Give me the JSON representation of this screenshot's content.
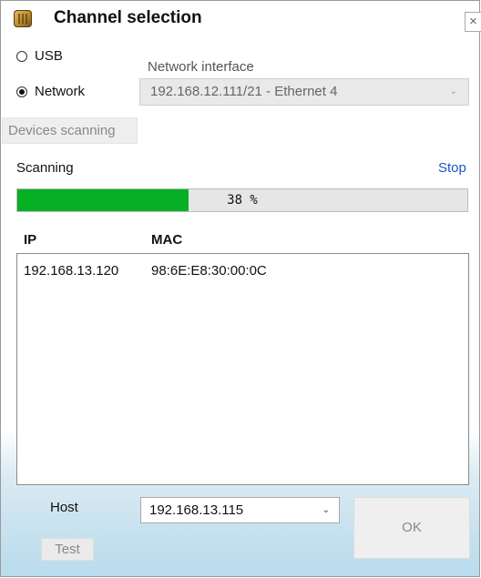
{
  "window": {
    "title": "Channel selection",
    "close_glyph": "×"
  },
  "channel": {
    "options": [
      {
        "label": "USB",
        "checked": false
      },
      {
        "label": "Network",
        "checked": true
      }
    ]
  },
  "network_interface": {
    "label": "Network interface",
    "selected": "192.168.12.111/21 - Ethernet 4",
    "enabled": false
  },
  "scan": {
    "button_label": "Devices scanning",
    "status": "Scanning",
    "stop_label": "Stop",
    "progress_percent": 38,
    "progress_text": "38 %",
    "progress_color": "#06b025"
  },
  "devices": {
    "columns": [
      "IP",
      "MAC"
    ],
    "rows": [
      {
        "ip": "192.168.13.120",
        "mac": "98:6E:E8:30:00:0C"
      }
    ]
  },
  "host": {
    "label": "Host",
    "selected": "192.168.13.115",
    "test_label": "Test",
    "ok_label": "OK"
  },
  "icons": {
    "app": "box-icon",
    "dropdown": "chevron-down-icon"
  },
  "colors": {
    "link": "#1a55c9",
    "accent_bg": "#b8dbec"
  }
}
